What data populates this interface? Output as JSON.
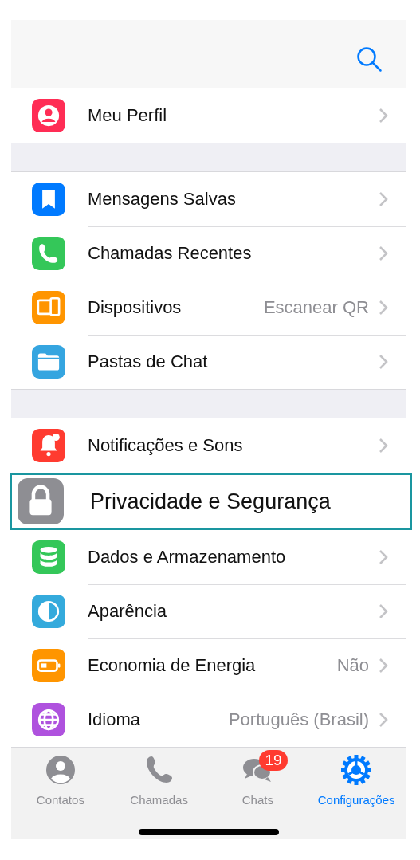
{
  "header": {
    "search": true
  },
  "sections": [
    {
      "rows": [
        {
          "label": "Meu Perfil",
          "highlighted": false
        }
      ]
    },
    {
      "rows": [
        {
          "label": "Mensagens Salvas",
          "highlighted": false
        },
        {
          "label": "Chamadas Recentes",
          "highlighted": false
        },
        {
          "label": "Dispositivos",
          "value": "Escanear QR",
          "highlighted": false
        },
        {
          "label": "Pastas de Chat",
          "highlighted": false
        }
      ]
    },
    {
      "rows": [
        {
          "label": "Notificações e Sons",
          "highlighted": false
        },
        {
          "label": "Privacidade e Segurança",
          "highlighted": true
        },
        {
          "label": "Dados e Armazenamento",
          "highlighted": false
        },
        {
          "label": "Aparência",
          "highlighted": false
        },
        {
          "label": "Economia de Energia",
          "value": "Não",
          "highlighted": false
        },
        {
          "label": "Idioma",
          "value": "Português (Brasil)",
          "highlighted": false
        }
      ]
    }
  ],
  "tabs": [
    {
      "label": "Contatos",
      "selected": false
    },
    {
      "label": "Chamadas",
      "selected": false
    },
    {
      "label": "Chats",
      "selected": false,
      "badge": "19"
    },
    {
      "label": "Configurações",
      "selected": true
    }
  ]
}
